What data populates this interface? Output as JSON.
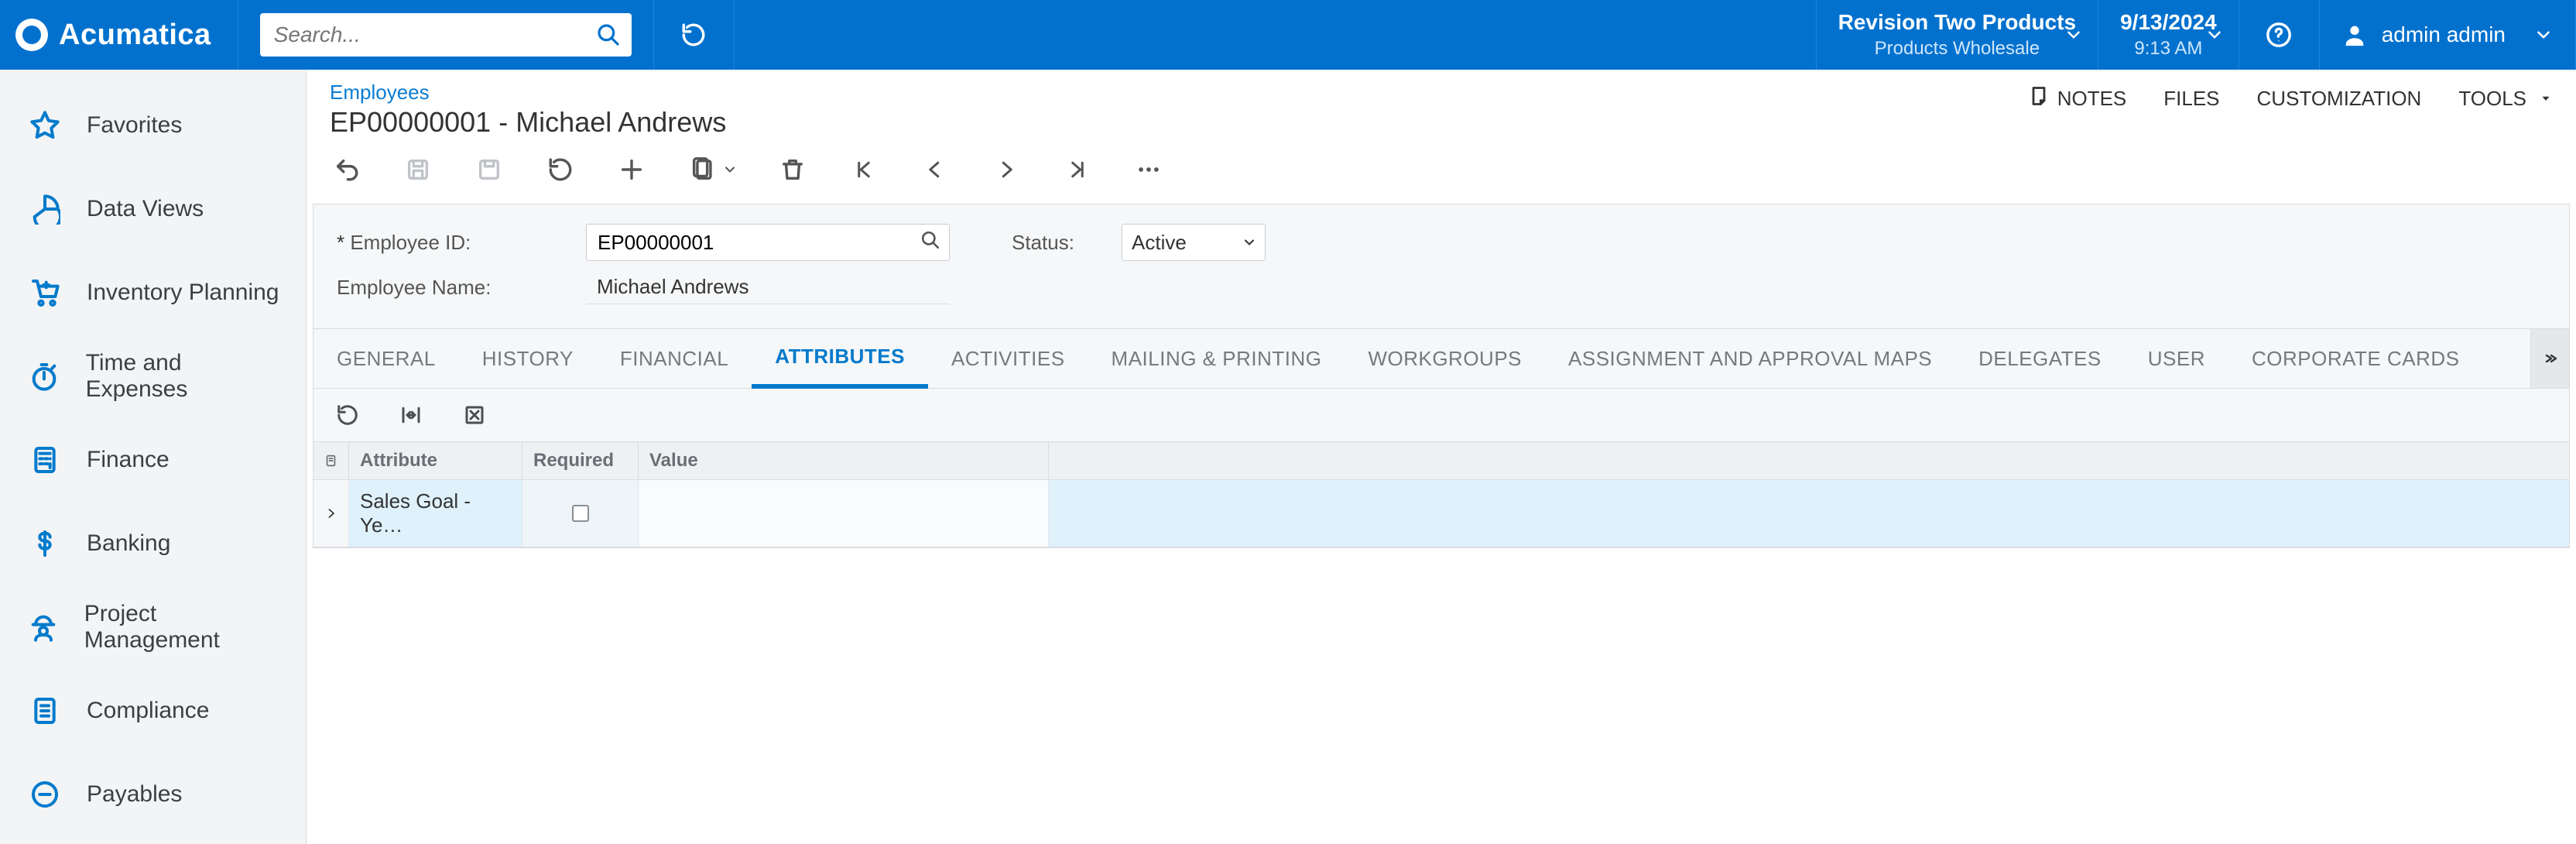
{
  "brand": {
    "name": "Acumatica"
  },
  "search": {
    "placeholder": "Search..."
  },
  "tenant": {
    "name": "Revision Two Products",
    "sub": "Products Wholesale"
  },
  "datetime": {
    "date": "9/13/2024",
    "time": "9:13 AM"
  },
  "user": {
    "name": "admin admin"
  },
  "sidebar": {
    "items": [
      {
        "label": "Favorites",
        "icon": "star"
      },
      {
        "label": "Data Views",
        "icon": "pie"
      },
      {
        "label": "Inventory Planning",
        "icon": "cart"
      },
      {
        "label": "Time and Expenses",
        "icon": "stopwatch"
      },
      {
        "label": "Finance",
        "icon": "calculator"
      },
      {
        "label": "Banking",
        "icon": "dollar"
      },
      {
        "label": "Project Management",
        "icon": "worker"
      },
      {
        "label": "Compliance",
        "icon": "checklist"
      },
      {
        "label": "Payables",
        "icon": "minus-circle"
      }
    ]
  },
  "page": {
    "module": "Employees",
    "title": "EP00000001 - Michael Andrews",
    "links": {
      "notes": "NOTES",
      "files": "FILES",
      "customization": "CUSTOMIZATION",
      "tools": "TOOLS"
    }
  },
  "form": {
    "employee_id_label": "Employee ID:",
    "employee_id": "EP00000001",
    "employee_name_label": "Employee Name:",
    "employee_name": "Michael Andrews",
    "status_label": "Status:",
    "status": "Active"
  },
  "tabs": [
    {
      "label": "GENERAL"
    },
    {
      "label": "HISTORY"
    },
    {
      "label": "FINANCIAL"
    },
    {
      "label": "ATTRIBUTES",
      "active": true
    },
    {
      "label": "ACTIVITIES"
    },
    {
      "label": "MAILING & PRINTING"
    },
    {
      "label": "WORKGROUPS"
    },
    {
      "label": "ASSIGNMENT AND APPROVAL MAPS"
    },
    {
      "label": "DELEGATES"
    },
    {
      "label": "USER"
    },
    {
      "label": "CORPORATE CARDS"
    }
  ],
  "grid": {
    "columns": {
      "attribute": "Attribute",
      "required": "Required",
      "value": "Value"
    },
    "rows": [
      {
        "attribute": "Sales Goal - Ye…",
        "required": false,
        "value": ""
      }
    ]
  }
}
